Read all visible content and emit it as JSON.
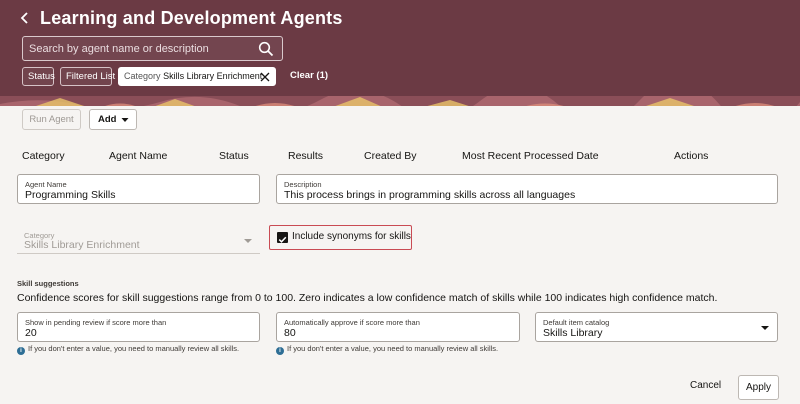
{
  "header": {
    "title": "Learning and Development Agents",
    "back_icon": "chevron-left-icon",
    "search_placeholder": "Search by agent name or description",
    "search_icon": "search-icon",
    "bg_color": "#6b3a44"
  },
  "filters": {
    "status": "Status",
    "filtered_list": "Filtered List",
    "category_label": "Category",
    "category_value": "Skills Library Enrichment",
    "clear": "Clear (1)"
  },
  "toolbar": {
    "run_agent": "Run Agent",
    "add": "Add"
  },
  "columns": [
    "Category",
    "Agent Name",
    "Status",
    "Results",
    "Created By",
    "Most Recent Processed Date",
    "Actions"
  ],
  "form": {
    "agent_name": {
      "label": "Agent Name",
      "value": "Programming Skills"
    },
    "description": {
      "label": "Description",
      "value": "This process brings in programming skills across all languages"
    },
    "category": {
      "label": "Category",
      "value": "Skills Library Enrichment"
    },
    "include_synonyms": {
      "label": "Include synonyms for skills",
      "checked": true
    },
    "skill_suggestions": {
      "title": "Skill suggestions",
      "description": "Confidence scores for skill suggestions range from 0 to 100. Zero indicates a low confidence match of skills while 100 indicates high confidence match."
    },
    "pending_review": {
      "label": "Show in pending review if score more than",
      "value": "20",
      "help": "If you don't enter a value, you need to manually review all skills."
    },
    "auto_approve": {
      "label": "Automatically approve if score more than",
      "value": "80",
      "help": "If you don't enter a value, you need to manually review all skills."
    },
    "item_catalog": {
      "label": "Default item catalog",
      "value": "Skills Library"
    }
  },
  "actions": {
    "cancel": "Cancel",
    "apply": "Apply"
  }
}
